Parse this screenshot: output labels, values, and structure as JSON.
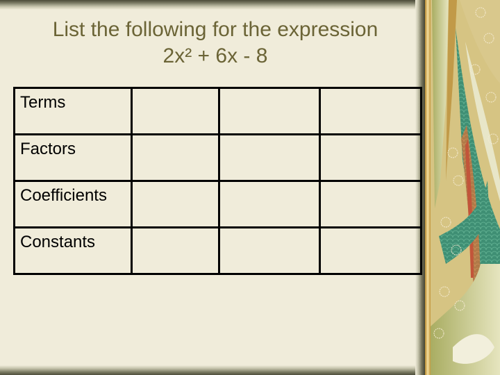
{
  "slide": {
    "title_line1": "List the following for the expression",
    "title_line2": "2x² + 6x - 8",
    "table": {
      "rows": [
        {
          "label": "Terms",
          "cells": [
            "",
            "",
            ""
          ]
        },
        {
          "label": "Factors",
          "cells": [
            "",
            "",
            ""
          ]
        },
        {
          "label": "Coefficients",
          "cells": [
            "",
            "",
            ""
          ]
        },
        {
          "label": "Constants",
          "cells": [
            "",
            "",
            ""
          ]
        }
      ]
    }
  },
  "colors": {
    "background": "#f0ecda",
    "title_text": "#6b6436",
    "table_border": "#000000",
    "decor_gold": "#d8c88a",
    "decor_teal": "#3f8f74",
    "decor_red": "#c2553a"
  },
  "decoration": {
    "right_panel": "kimono-pattern-icon"
  }
}
